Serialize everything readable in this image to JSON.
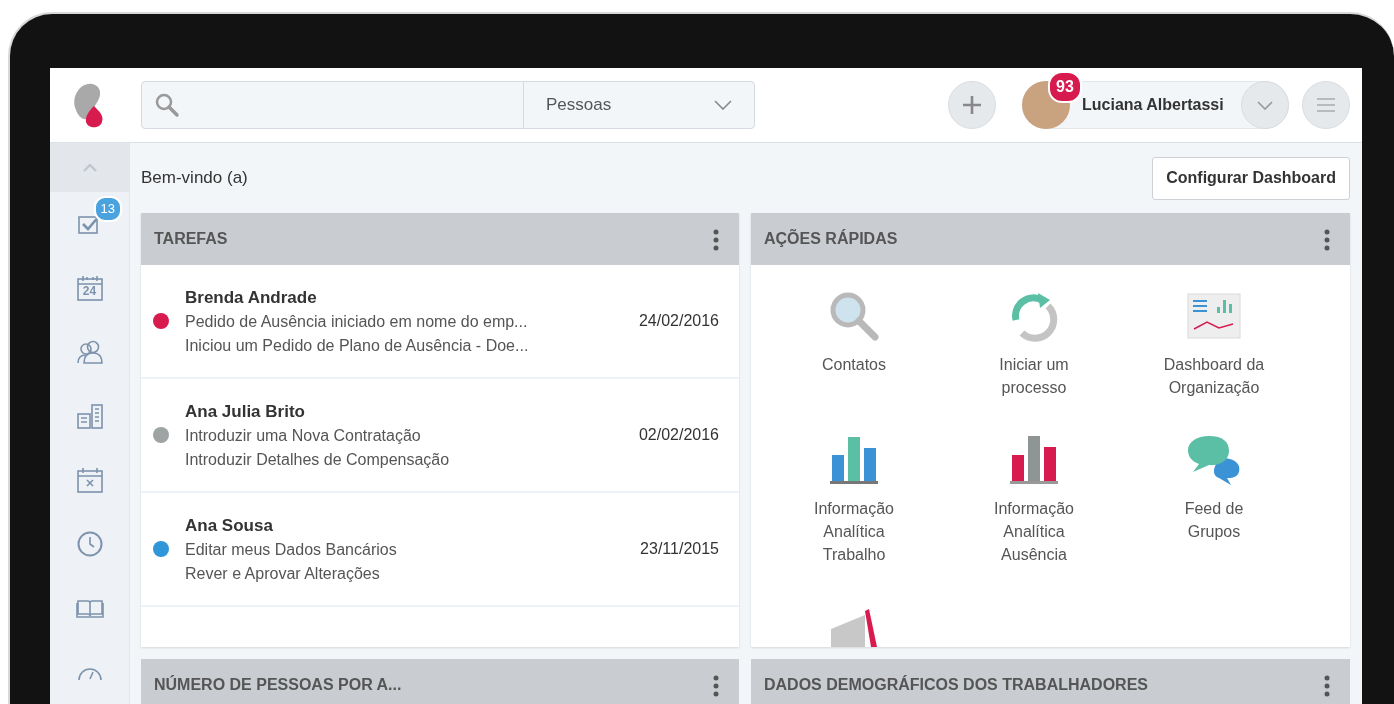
{
  "header": {
    "scope_select": {
      "value": "Pessoas"
    },
    "user": {
      "name": "Luciana Albertassi",
      "badge": "93"
    }
  },
  "sidebar": {
    "items": [
      {
        "kind": "collapse",
        "selected": true
      },
      {
        "kind": "tasks",
        "badge": "13",
        "selected": false
      },
      {
        "kind": "calendar",
        "text": "24",
        "selected": false
      },
      {
        "kind": "people",
        "selected": false
      },
      {
        "kind": "building",
        "selected": false
      },
      {
        "kind": "calendar-x",
        "selected": false
      },
      {
        "kind": "clock",
        "selected": false
      },
      {
        "kind": "book",
        "selected": false
      },
      {
        "kind": "gauge",
        "selected": false
      }
    ]
  },
  "welcome": "Bem-vindo (a)",
  "configure_button": "Configurar Dashboard",
  "tasks_card": {
    "title": "TAREFAS",
    "rows": [
      {
        "name": "Brenda Andrade",
        "line1": "Pedido de Ausência iniciado em nome do emp...",
        "line2": "Iniciou um Pedido de Plano de Ausência - Doe...",
        "date": "24/02/2016",
        "color": "#d81b4f"
      },
      {
        "name": "Ana Julia Brito",
        "line1": "Introduzir uma Nova Contratação",
        "line2": "Introduzir Detalhes de Compensação",
        "date": "02/02/2016",
        "color": "#9ea3a3"
      },
      {
        "name": "Ana Sousa",
        "line1": "Editar meus Dados Bancários",
        "line2": "Rever e Aprovar Alterações",
        "date": "23/11/2015",
        "color": "#2f96d9"
      }
    ]
  },
  "quick_actions_card": {
    "title": "AÇÕES RÁPIDAS",
    "items": [
      {
        "kind": "search",
        "label": "Contatos"
      },
      {
        "kind": "process",
        "label": "Iniciar um processo"
      },
      {
        "kind": "dashboard",
        "label": "Dashboard da Organização"
      },
      {
        "kind": "bars-blue",
        "label": "Informação Analítica Trabalho"
      },
      {
        "kind": "bars-red",
        "label": "Informação Analítica Ausência"
      },
      {
        "kind": "chat",
        "label": "Feed de Grupos"
      },
      {
        "kind": "megaphone"
      }
    ]
  },
  "bottom_cards": [
    {
      "title": "NÚMERO DE PESSOAS POR A..."
    },
    {
      "title": "DADOS DEMOGRÁFICOS DOS TRABALHADORES"
    }
  ]
}
